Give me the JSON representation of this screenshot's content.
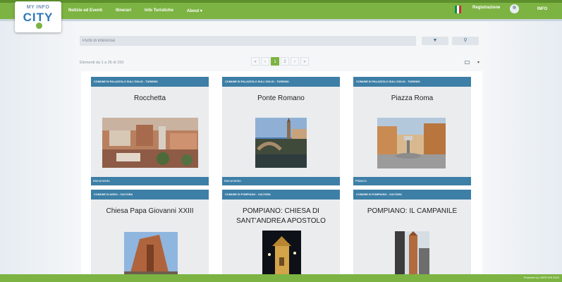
{
  "logo": {
    "top": "MY INFO",
    "main": "CITY"
  },
  "nav": [
    "Notizie ed Eventi",
    "Itinerari",
    "Info Turistiche",
    "About ▾"
  ],
  "header": {
    "registration": "Registrazione",
    "flag_colors": [
      "#009246",
      "#ffffff",
      "#ce2b37"
    ],
    "edu_logo": "INFO"
  },
  "search": {
    "placeholder": "Punti di interesse",
    "filter_icon": "funnel-icon",
    "search_icon": "search-icon",
    "filter_glyph": "▼",
    "search_glyph": "⚲"
  },
  "counter": "Elementi da 1 a 25 di 150",
  "pagination": {
    "prev2": "«",
    "prev1": "‹",
    "current": "1",
    "next_page": "2",
    "next1": "›",
    "next2": "»"
  },
  "view": {
    "dropdown": "▾"
  },
  "cards": [
    {
      "category": "COMUNE DI PALAZZOLO SULL'OGLIO - TURISMO",
      "title": "Rocchetta",
      "footer": "Monumento"
    },
    {
      "category": "COMUNE DI PALAZZOLO SULL'OGLIO - TURISMO",
      "title": "Ponte Romano",
      "footer": "Monumento"
    },
    {
      "category": "COMUNE DI PALAZZOLO SULL'OGLIO - TURISMO",
      "title": "Piazza Roma",
      "footer": "Palazzo"
    },
    {
      "category": "COMUNE DI ADRO - CULTURA",
      "title": "Chiesa Papa Giovanni XXIII",
      "footer": ""
    },
    {
      "category": "COMUNE DI POMPIANO - CULTURA",
      "title": "POMPIANO: CHIESA DI SANT'ANDREA APOSTOLO",
      "footer": ""
    },
    {
      "category": "COMUNE DI POMPIANO - CULTURA",
      "title": "POMPIANO: IL CAMPANILE",
      "footer": ""
    }
  ],
  "footer": {
    "text": "Powered by USER IPA 2023"
  },
  "colors": {
    "green": "#7cb342",
    "blue": "#3d7fa6"
  }
}
